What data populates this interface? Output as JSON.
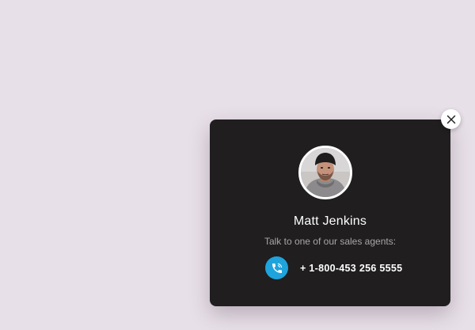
{
  "agent": {
    "name": "Matt Jenkins",
    "subtitle": "Talk to one of our sales agents:",
    "phone": "+ 1-800-453 256 5555"
  },
  "icons": {
    "close": "close-icon",
    "phone": "phone-icon",
    "avatar": "agent-avatar"
  },
  "colors": {
    "background": "#e8e0e8",
    "card": "#201e1f",
    "phone_accent": "#1fa3dc",
    "name_text": "#ffffff",
    "subtitle_text": "#a9a6a8"
  }
}
